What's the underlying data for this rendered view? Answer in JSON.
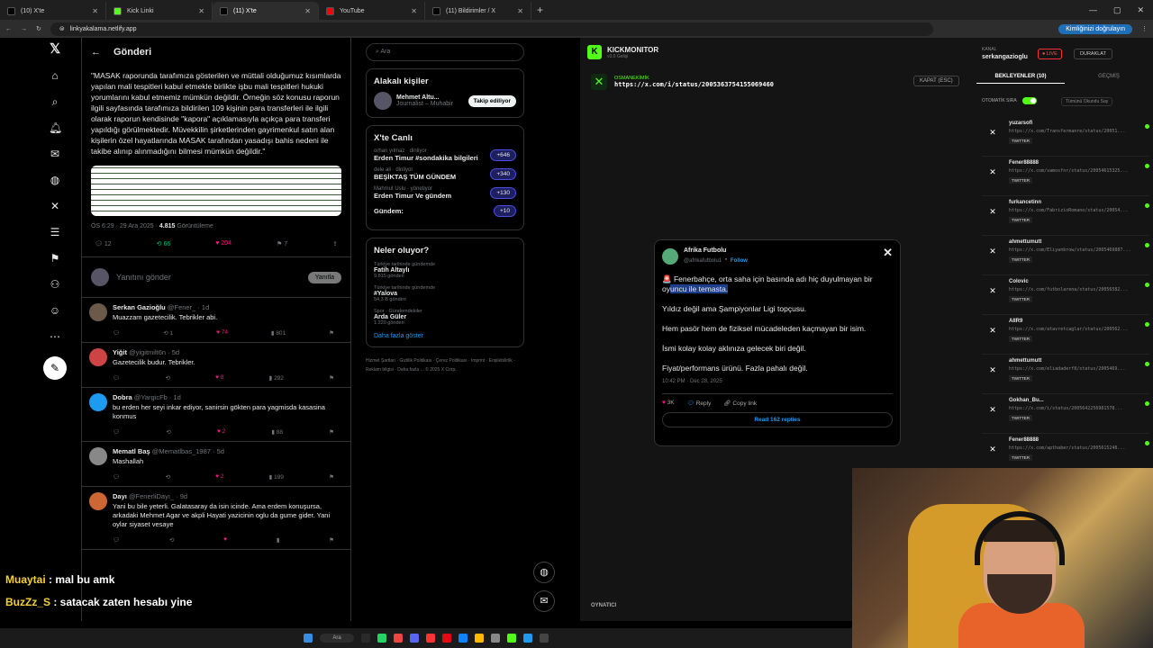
{
  "browser": {
    "tabs": [
      {
        "label": "(10) X'te",
        "color": "#000000"
      },
      {
        "label": "Kick Linki",
        "color": "#53fc18"
      },
      {
        "label": "(11) X'te",
        "color": "#000000"
      },
      {
        "label": "YouTube",
        "color": "#ff0000"
      },
      {
        "label": "(11) Bildirimler / X",
        "color": "#000000"
      }
    ],
    "url": "linkyakalama.netlify.app",
    "verify_label": "Kimliğinizi doğrulayın"
  },
  "x_main": {
    "header": "Gönderi",
    "quote": "\"MASAK raporunda tarafımıza gösterilen ve müttali olduğumuz kısımlarda yapılan mali tespitleri kabul etmekle birlikte işbu mali tespitleri hukuki yorumlarını kabul etmemiz mümkün değildir. Örneğin söz konusu raporun ilgili sayfasında tarafımıza bildirilen 109 kişinin para transferleri ile ilgili olarak raporun kendisinde \"kapora\" açıklamasıyla açıkça para transferi yapıldığı görülmektedir. Müvekkilin şirketlerinden gayrimenkul satın alan kişilerin özel hayatlarında MASAK tarafından yasadışı bahis nedeni ile takibe alınıp alınmadığını bilmesi mümkün değildir.\"",
    "time": "ÖS 6:29 · 29 Ara 2025 ·",
    "views_count": "4.815",
    "views_label": "Görüntüleme",
    "actions": {
      "replies": "12",
      "reposts": "66",
      "likes": "204",
      "bookmarks": "7"
    },
    "reply_placeholder": "Yanıtını gönder",
    "reply_button": "Yanıtla",
    "replies": [
      {
        "name": "Serkan Gazioğlu",
        "handle": "@Fener_ · 1d",
        "text": "Muazzam gazetecilik. Tebrikler abi.",
        "rt": "1",
        "like": "74",
        "views": "801",
        "avcolor": "#6b5a4a"
      },
      {
        "name": "Yiğit",
        "handle": "@yigitmilt6n · 5d",
        "text": "Gazetecilik budur. Tebrikler.",
        "rt": "",
        "like": "8",
        "views": "292",
        "avcolor": "#c44"
      },
      {
        "name": "Dobra",
        "handle": "@YargicFb · 1d",
        "text": "bu erden her seyi inkar ediyor, sanirsin gökten para yagmisda kasasina konmus",
        "rt": "",
        "like": "2",
        "views": "88",
        "avcolor": "#1d9bf0"
      },
      {
        "name": "Mematl Baş",
        "handle": "@Mematlbas_1987 · 5d",
        "text": "Mashallah",
        "rt": "",
        "like": "2",
        "views": "199",
        "avcolor": "#888"
      },
      {
        "name": "Dayı",
        "handle": "@FenerliDayı_ · 9d",
        "text": "Yani bu bile yeterli. Galatasaray da isin icinde. Ama erdem konuşursa, arkadaki Mehmet Agar ve akpli Hayati yazicinin oglu da gume gider. Yani oylar siyaset vesaye",
        "rt": "",
        "like": "",
        "views": "",
        "avcolor": "#c63"
      }
    ]
  },
  "x_right": {
    "search_placeholder": "Ara",
    "people_title": "Alakalı kişiler",
    "person_name": "Mehmet Altu...",
    "person_role": "Journalist – Muhabir",
    "follow_label": "Takip ediliyor",
    "live_title": "X'te Canlı",
    "live": [
      {
        "host": "orhan yılmaz · dinliyor",
        "title": "Erden Timur #sondakika bilgileri",
        "count": "+646"
      },
      {
        "host": "dele ali · dinliyor",
        "title": "BEŞİKTAŞ TÜM GÜNDEM",
        "count": "+340"
      },
      {
        "host": "Mahmut Uslu · yönetiyor",
        "title": "Erden Timur Ve gündem",
        "count": "+130"
      },
      {
        "host": "",
        "title": "Gündem:",
        "count": "+10"
      }
    ],
    "trends_title": "Neler oluyor?",
    "trends": [
      {
        "ctx": "Türkiye tarihinde gündemde",
        "name": "Fatih Altaylı",
        "count": "9.815 gönderi"
      },
      {
        "ctx": "Türkiye tarihinde gündemde",
        "name": "#Yalova",
        "count": "54,3 B gönderi"
      },
      {
        "ctx": "Spor · Gündemdekiler",
        "name": "Arda Güler",
        "count": "1.220 gönderi"
      }
    ],
    "more_label": "Daha fazla göster",
    "footer": "Hizmet Şartları · Gizlilik Politikası · Çerez Politikası · Imprint · Erişilebilirlik · Reklam bilgisi · Daha fazla ... © 2025 X Corp."
  },
  "chat": [
    {
      "user": "Muaytai",
      "msg": " : mal bu amk"
    },
    {
      "user": "BuzZz_S",
      "msg": " : satacak zaten hesabı yine"
    }
  ],
  "kick": {
    "title": "KICKMONITOR",
    "version": "v3.0 Gelişi",
    "user": "serkangazioglu",
    "user_label": "KANAL",
    "live": "● LIVE",
    "stop": "DURAKLAT",
    "current_label": "OSMANEKİMİK",
    "current_url": "https://x.com/i/status/2005363754155069460",
    "close": "KAPAT (ESC)",
    "tab_wait": "BEKLEYENLER (10)",
    "tab_history": "GEÇMİŞ",
    "auto_label": "OTOMATİK SIRA",
    "clear_all": "Tümünü Okundu Say",
    "player_label": "OYNATICI",
    "queue": [
      {
        "name": "yuzarsofi",
        "url": "https://x.com/Transfermanre/status/20051..."
      },
      {
        "name": "Fener88888",
        "url": "https://x.com/vamosfnr/status/20054615325..."
      },
      {
        "name": "furkancetinn",
        "url": "https://x.com/FabrizioRomano/status/20054..."
      },
      {
        "name": "ahmettumutt",
        "url": "https://x.com/Eliyanbrow/status/2005469887..."
      },
      {
        "name": "Colovic",
        "url": "https://x.com/futbolarena/status/20056582..."
      },
      {
        "name": "AIIR9",
        "url": "https://x.com/atavretcaglar/status/200562..."
      },
      {
        "name": "ahmettumutt",
        "url": "https://x.com/eliadaderf8/status/2005469..."
      },
      {
        "name": "Gokhan_Bu...",
        "url": "https://x.com/i/status/2005642256981578..."
      },
      {
        "name": "Fener88888",
        "url": "https://x.com/apthaber/status/2005615248..."
      }
    ],
    "queue_badge": "TWITTER"
  },
  "embed": {
    "name": "Afrika Futbolu",
    "handle": "@afrikafutbolu1",
    "follow": "Follow",
    "p1a": "🚨 Fenerbahçe, orta saha için basında adı hiç duyulmayan bir oy",
    "p1b": "uncu ile temasta.",
    "p2": "Yıldız değil ama Şampiyonlar Ligi topçusu.",
    "p3": "Hem pasör hem de fiziksel mücadeleden kaçmayan bir isim.",
    "p4": "İsmi kolay kolay aklınıza gelecek biri değil.",
    "p5": "Fiyat/performans ürünü. Fazla pahalı değil.",
    "date": "10:42 PM · Dec 28, 2025",
    "likes": "3K",
    "reply": "Reply",
    "copy": "Copy link",
    "read": "Read 162 replies"
  },
  "taskbar": {
    "search": "Ara"
  }
}
